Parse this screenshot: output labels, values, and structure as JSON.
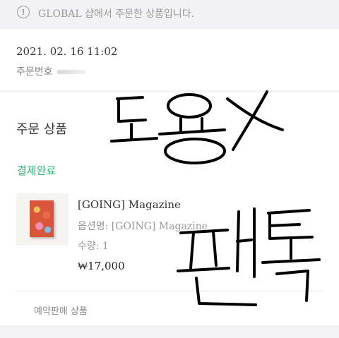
{
  "notice": {
    "icon": "exclamation-circle-icon",
    "text": "GLOBAL 샵에서 주문한 상품입니다."
  },
  "order": {
    "date": "2021. 02. 16 11:02",
    "number_label": "주문번호"
  },
  "section": {
    "title": "주문 상품",
    "status": "결제완료",
    "status_color": "#2bb673"
  },
  "item": {
    "name": "[GOING] Magazine",
    "option": "옵션명: [GOING] Magazine",
    "quantity": "수량: 1",
    "price": "₩17,000",
    "badge": "예약판매 상품"
  },
  "overlay": {
    "handwriting_1": "도용X",
    "handwriting_2": "팬톡"
  }
}
